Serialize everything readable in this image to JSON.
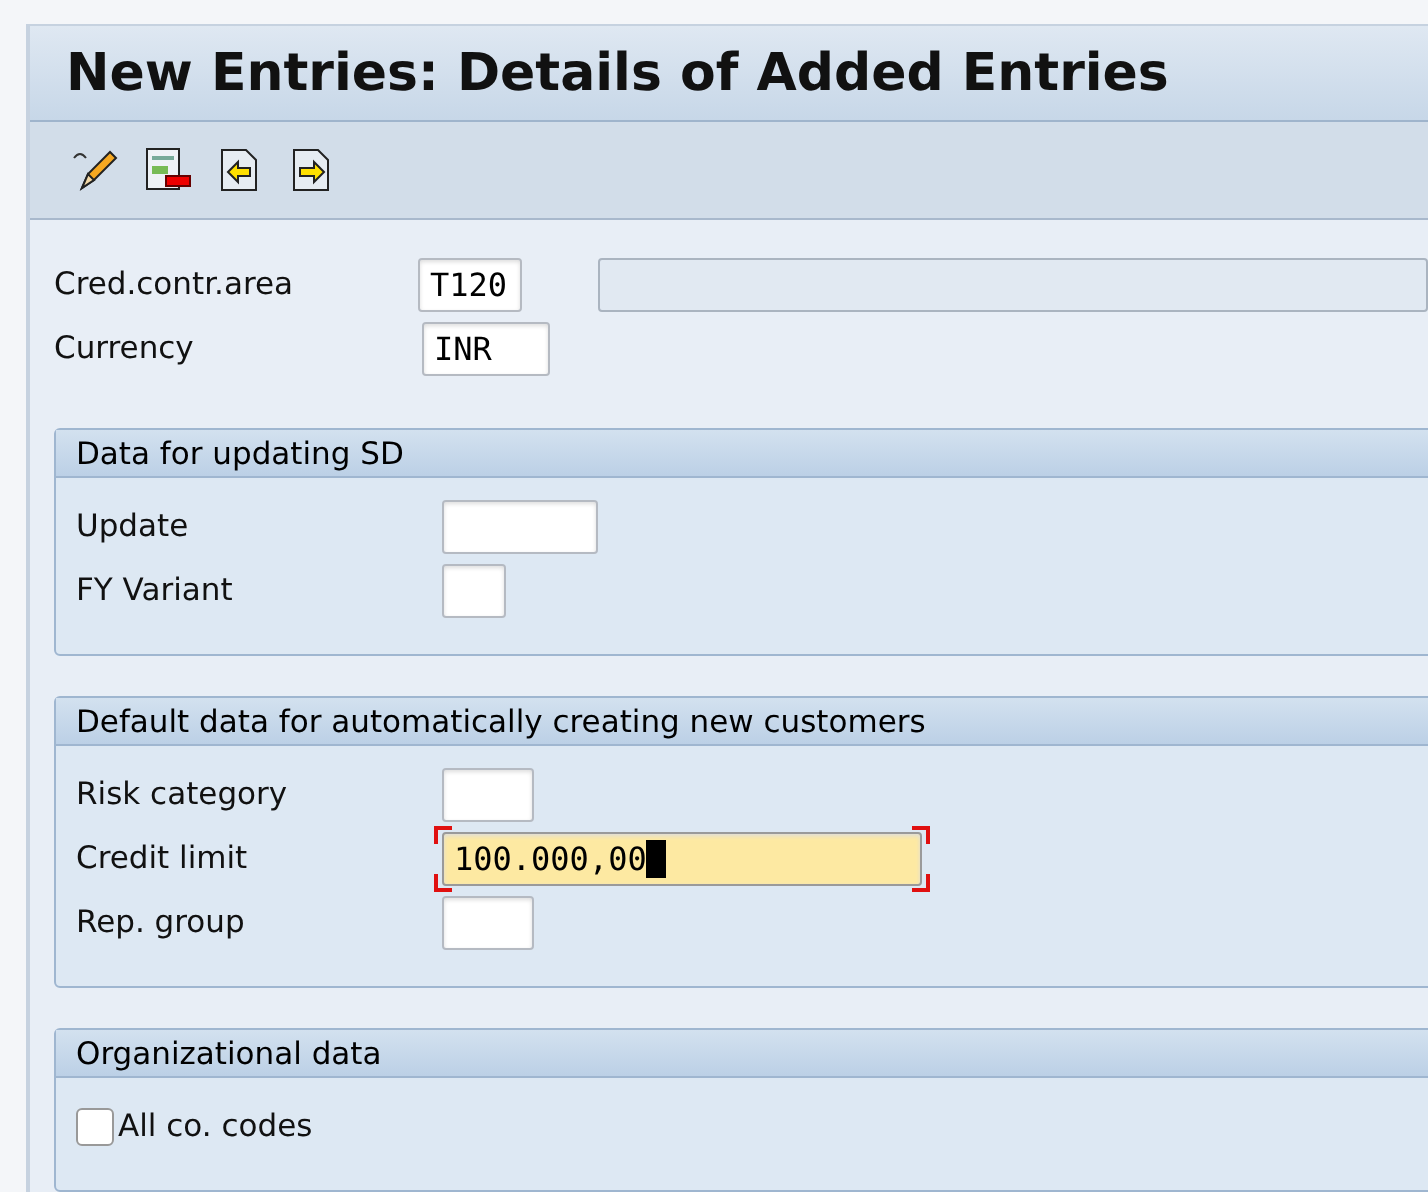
{
  "window": {
    "title": "New Entries: Details of Added Entries"
  },
  "toolbar": {
    "buttons": [
      {
        "kind": "edit"
      },
      {
        "kind": "delete"
      },
      {
        "kind": "previous"
      },
      {
        "kind": "next"
      }
    ]
  },
  "header_fields": [
    {
      "label": "Cred.contr.area",
      "value": "T120",
      "focused": false,
      "has_description": true
    },
    {
      "label": "Currency",
      "value": "INR",
      "focused": false,
      "has_description": false
    }
  ],
  "groups": [
    {
      "title": "Data for updating SD",
      "rows": [
        {
          "kind": "field",
          "label": "Update",
          "value": "",
          "focused": false
        },
        {
          "kind": "field",
          "label": "FY Variant",
          "value": "",
          "focused": false
        }
      ]
    },
    {
      "title": "Default data for automatically creating new customers",
      "rows": [
        {
          "kind": "field",
          "label": "Risk category",
          "value": "",
          "focused": false
        },
        {
          "kind": "field",
          "label": "Credit limit",
          "value": "100.000,00",
          "focused": true
        },
        {
          "kind": "field",
          "label": "Rep. group",
          "value": "",
          "focused": false
        }
      ]
    },
    {
      "title": "Organizational data",
      "rows": [
        {
          "kind": "checkbox",
          "label": "All co. codes",
          "checked": false
        }
      ]
    }
  ]
}
